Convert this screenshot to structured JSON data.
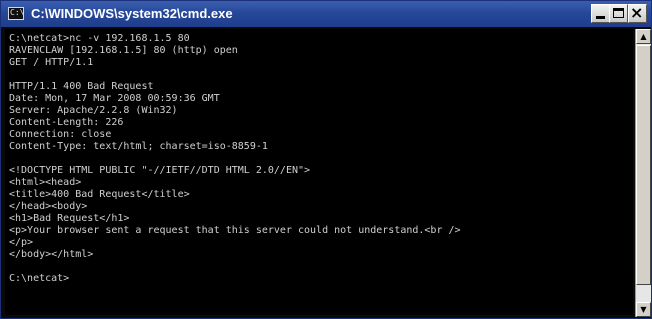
{
  "window": {
    "title": "C:\\WINDOWS\\system32\\cmd.exe",
    "icon_text": "C:\\"
  },
  "titlebar_buttons": {
    "minimize": "_",
    "maximize": "□",
    "close": "×"
  },
  "console": {
    "lines": [
      "C:\\netcat>nc -v 192.168.1.5 80",
      "RAVENCLAW [192.168.1.5] 80 (http) open",
      "GET / HTTP/1.1",
      "",
      "HTTP/1.1 400 Bad Request",
      "Date: Mon, 17 Mar 2008 00:59:36 GMT",
      "Server: Apache/2.2.8 (Win32)",
      "Content-Length: 226",
      "Connection: close",
      "Content-Type: text/html; charset=iso-8859-1",
      "",
      "<!DOCTYPE HTML PUBLIC \"-//IETF//DTD HTML 2.0//EN\">",
      "<html><head>",
      "<title>400 Bad Request</title>",
      "</head><body>",
      "<h1>Bad Request</h1>",
      "<p>Your browser sent a request that this server could not understand.<br />",
      "</p>",
      "</body></html>",
      "",
      "C:\\netcat>"
    ]
  },
  "scrollbar": {
    "up_arrow": "▲",
    "down_arrow": "▼"
  },
  "colors": {
    "titlebar": "#26489a",
    "console_bg": "#000000",
    "console_text": "#d0d0d0"
  }
}
